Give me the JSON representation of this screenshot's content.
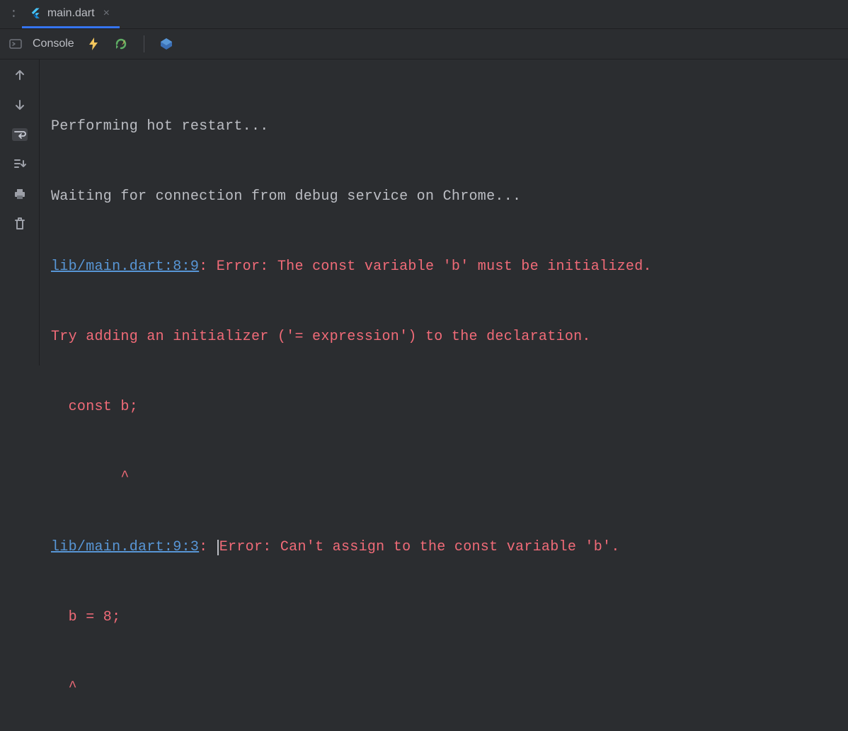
{
  "tab": {
    "filename": "main.dart",
    "close_glyph": "×"
  },
  "toolbar": {
    "label": "Console"
  },
  "console": {
    "line1": "Performing hot restart...",
    "line2": "Waiting for connection from debug service on Chrome...",
    "err1_link": "lib/main.dart:8:9",
    "err1_rest": ": Error: The const variable 'b' must be initialized.",
    "err1_hint": "Try adding an initializer ('= expression') to the declaration.",
    "err1_code": "  const b;",
    "err1_caret": "        ^",
    "err2_link": "lib/main.dart:9:3",
    "err2_sep": ": ",
    "err2_rest": "Error: Can't assign to the const variable 'b'.",
    "err2_code": "  b = 8;",
    "err2_caret": "  ^"
  }
}
